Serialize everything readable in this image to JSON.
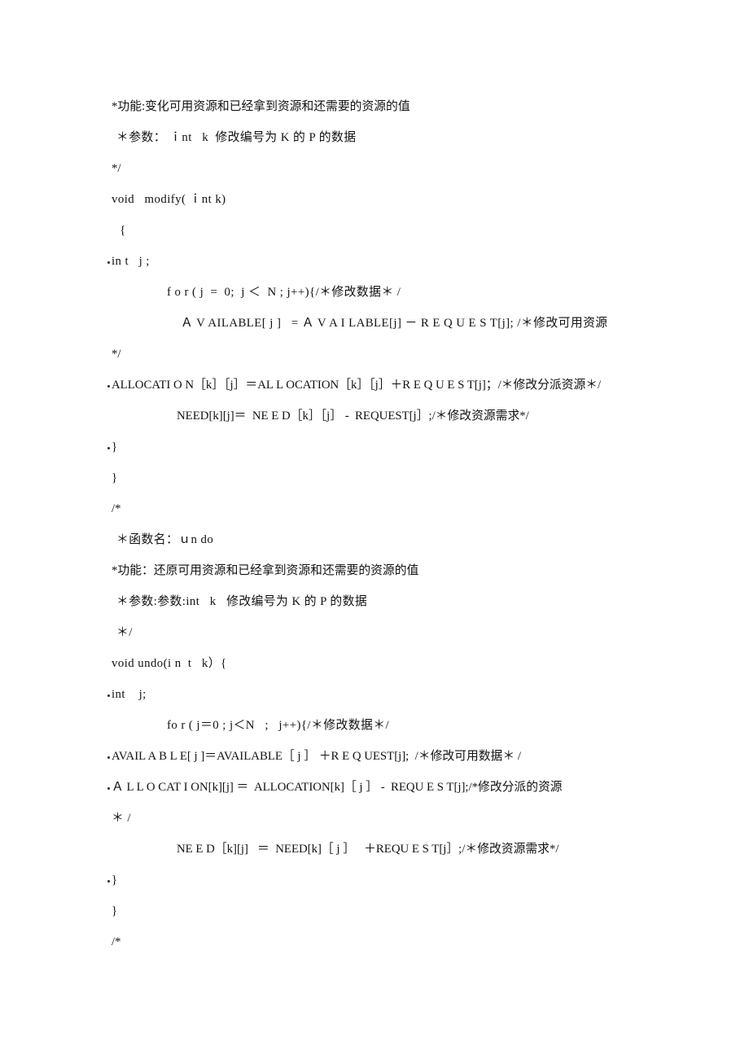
{
  "document": {
    "page_background": "#ffffff",
    "text_color": "#1a1a1a",
    "language": "zh-CN",
    "content_type": "c-source-code-listing"
  },
  "lines": [
    {
      "id": "l01",
      "text": "*功能:变化可用资源和已经拿到资源和还需要的资源的值",
      "indent": "ind-0",
      "bullet": false,
      "spacing": "ls-tight"
    },
    {
      "id": "l02",
      "text": "＊参数： ｉnt   k  修改编号为 K 的 P 的数据",
      "indent": "ind-sp",
      "bullet": false,
      "spacing": "ls-med"
    },
    {
      "id": "l03",
      "text": "*/",
      "indent": "ind-0",
      "bullet": false,
      "spacing": "ls-tight"
    },
    {
      "id": "l04",
      "text": "void   modify( ｉnt k)",
      "indent": "ind-0",
      "bullet": false,
      "spacing": "ls-med"
    },
    {
      "id": "l05",
      "text": " {",
      "indent": "ind-sp",
      "bullet": false,
      "spacing": "ls-med"
    },
    {
      "id": "l06",
      "text": "in t   j ;",
      "indent": "ind-0",
      "bullet": true,
      "spacing": "ls-med"
    },
    {
      "id": "l07",
      "text": "f o r ( j  =  0;  j ＜  N ; j++){/＊修改数据＊ /",
      "indent": "ind-1",
      "bullet": false,
      "spacing": "ls-med"
    },
    {
      "id": "l08",
      "text": "Ａ V AILABLE[ j ]   = Ａ V A I LABLE[j] － R E Q U E S T[j]; /＊修改可用资源",
      "indent": "ind-2",
      "bullet": false,
      "spacing": "ls-med"
    },
    {
      "id": "l09",
      "text": "*/",
      "indent": "ind-0",
      "bullet": false,
      "spacing": "ls-tight"
    },
    {
      "id": "l10",
      "text": "ALLOCATI O N［k］［j］＝AL L OCATION［k］［j］＋R E Q U E S T[j]；/＊修改分派资源＊/",
      "indent": "ind-0",
      "bullet": true,
      "spacing": "ls-tight"
    },
    {
      "id": "l11",
      "text": "NEED[k][j]＝  NE E D［k］［j］ -  REQUEST[j］;/＊修改资源需求*/",
      "indent": "ind-3",
      "bullet": false,
      "spacing": "ls-tight"
    },
    {
      "id": "l12",
      "text": "}",
      "indent": "ind-0",
      "bullet": true,
      "spacing": "ls-med"
    },
    {
      "id": "l13",
      "text": "}",
      "indent": "ind-0",
      "bullet": false,
      "spacing": "ls-med"
    },
    {
      "id": "l14",
      "text": "/*",
      "indent": "ind-0",
      "bullet": false,
      "spacing": "ls-tight"
    },
    {
      "id": "l15",
      "text": "＊函数名：ｕn do",
      "indent": "ind-sp",
      "bullet": false,
      "spacing": "ls-med"
    },
    {
      "id": "l16",
      "text": "*功能：还原可用资源和已经拿到资源和还需要的资源的值",
      "indent": "ind-0",
      "bullet": false,
      "spacing": "ls-tight"
    },
    {
      "id": "l17",
      "text": "＊参数:参数:int   k   修改编号为 K 的 P 的数据",
      "indent": "ind-sp",
      "bullet": false,
      "spacing": "ls-med"
    },
    {
      "id": "l18",
      "text": "＊/",
      "indent": "ind-sp",
      "bullet": false,
      "spacing": "ls-med"
    },
    {
      "id": "l19",
      "text": "void undo(i n  t   k）{",
      "indent": "ind-0",
      "bullet": false,
      "spacing": "ls-med"
    },
    {
      "id": "l20",
      "text": "int    j;",
      "indent": "ind-0",
      "bullet": true,
      "spacing": "ls-med"
    },
    {
      "id": "l21",
      "text": "fo r ( j＝0 ; j＜N   ;   j++){/＊修改数据＊/",
      "indent": "ind-1",
      "bullet": false,
      "spacing": "ls-med"
    },
    {
      "id": "l22",
      "text": "AVAIL A B L E[ j ]＝AVAILABLE［ j ］ ＋R E Q UEST[j];  /＊修改可用数据＊ /",
      "indent": "ind-0",
      "bullet": true,
      "spacing": "ls-tight"
    },
    {
      "id": "l23",
      "text": "Ａ L L O CAT I ON[k][j] ＝  ALLOCATION[k]［ j ］ -  REQU E S T[j];/*修改分派的资源",
      "indent": "ind-0",
      "bullet": true,
      "spacing": "ls-tight"
    },
    {
      "id": "l24",
      "text": "＊ /",
      "indent": "ind-0",
      "bullet": false,
      "spacing": "ls-med"
    },
    {
      "id": "l25",
      "text": "NE E D［k][j]   ＝  NEED[k]［ j ］   ＋REQU E S T[j］;/＊修改资源需求*/",
      "indent": "ind-3",
      "bullet": false,
      "spacing": "ls-tight"
    },
    {
      "id": "l26",
      "text": "}",
      "indent": "ind-0",
      "bullet": true,
      "spacing": "ls-med"
    },
    {
      "id": "l27",
      "text": "}",
      "indent": "ind-0",
      "bullet": false,
      "spacing": "ls-med"
    },
    {
      "id": "l28",
      "text": "/*",
      "indent": "ind-0",
      "bullet": false,
      "spacing": "ls-tight"
    }
  ]
}
